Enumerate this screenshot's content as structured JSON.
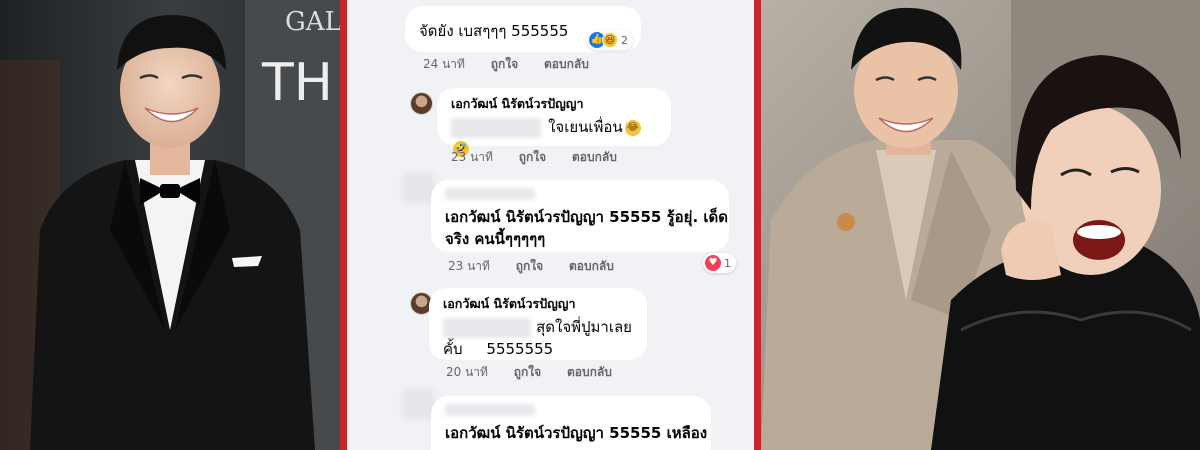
{
  "comments": [
    {
      "author": "",
      "text": "จัดยัง เบสๆๆๆ 555555",
      "time": "24 นาที",
      "like_label": "ถูกใจ",
      "reply_label": "ตอบกลับ",
      "reaction_count": "2",
      "reactions": [
        "like-icon",
        "haha-icon"
      ]
    },
    {
      "author": "เอกวัฒน์ นิรัตน์วรปัญญา",
      "text": "ใจเยนเพื่อน",
      "emoji": [
        "😂",
        "🤣"
      ],
      "time": "23 นาที",
      "like_label": "ถูกใจ",
      "reply_label": "ตอบกลับ"
    },
    {
      "author": "",
      "text_line1": "เอกวัฒน์ นิรัตน์วรปัญญา 55555 รู้อยุ่. เด็ด",
      "text_line2": "จริง คนนี้ๆๆๆๆๆ",
      "time": "23 นาที",
      "like_label": "ถูกใจ",
      "reply_label": "ตอบกลับ",
      "reaction_count": "1",
      "reactions": [
        "love-icon"
      ]
    },
    {
      "author": "เอกวัฒน์ นิรัตน์วรปัญญา",
      "text_line1": "สุดใจพี่ปูมาเลย",
      "text_line2": "คั้บ     5555555",
      "time": "20 นาที",
      "like_label": "ถูกใจ",
      "reply_label": "ตอบกลับ"
    },
    {
      "author": "",
      "text": "เอกวัฒน์ นิรัตน์วรปัญญา 55555 เหลือง"
    }
  ],
  "left_photo": {
    "backdrop_text": "GAL",
    "backdrop_text2": "TH"
  },
  "colors": {
    "accent_frame": "#c6262e",
    "panel_bg": "#f0f2f5",
    "bubble_bg": "#ffffff"
  }
}
